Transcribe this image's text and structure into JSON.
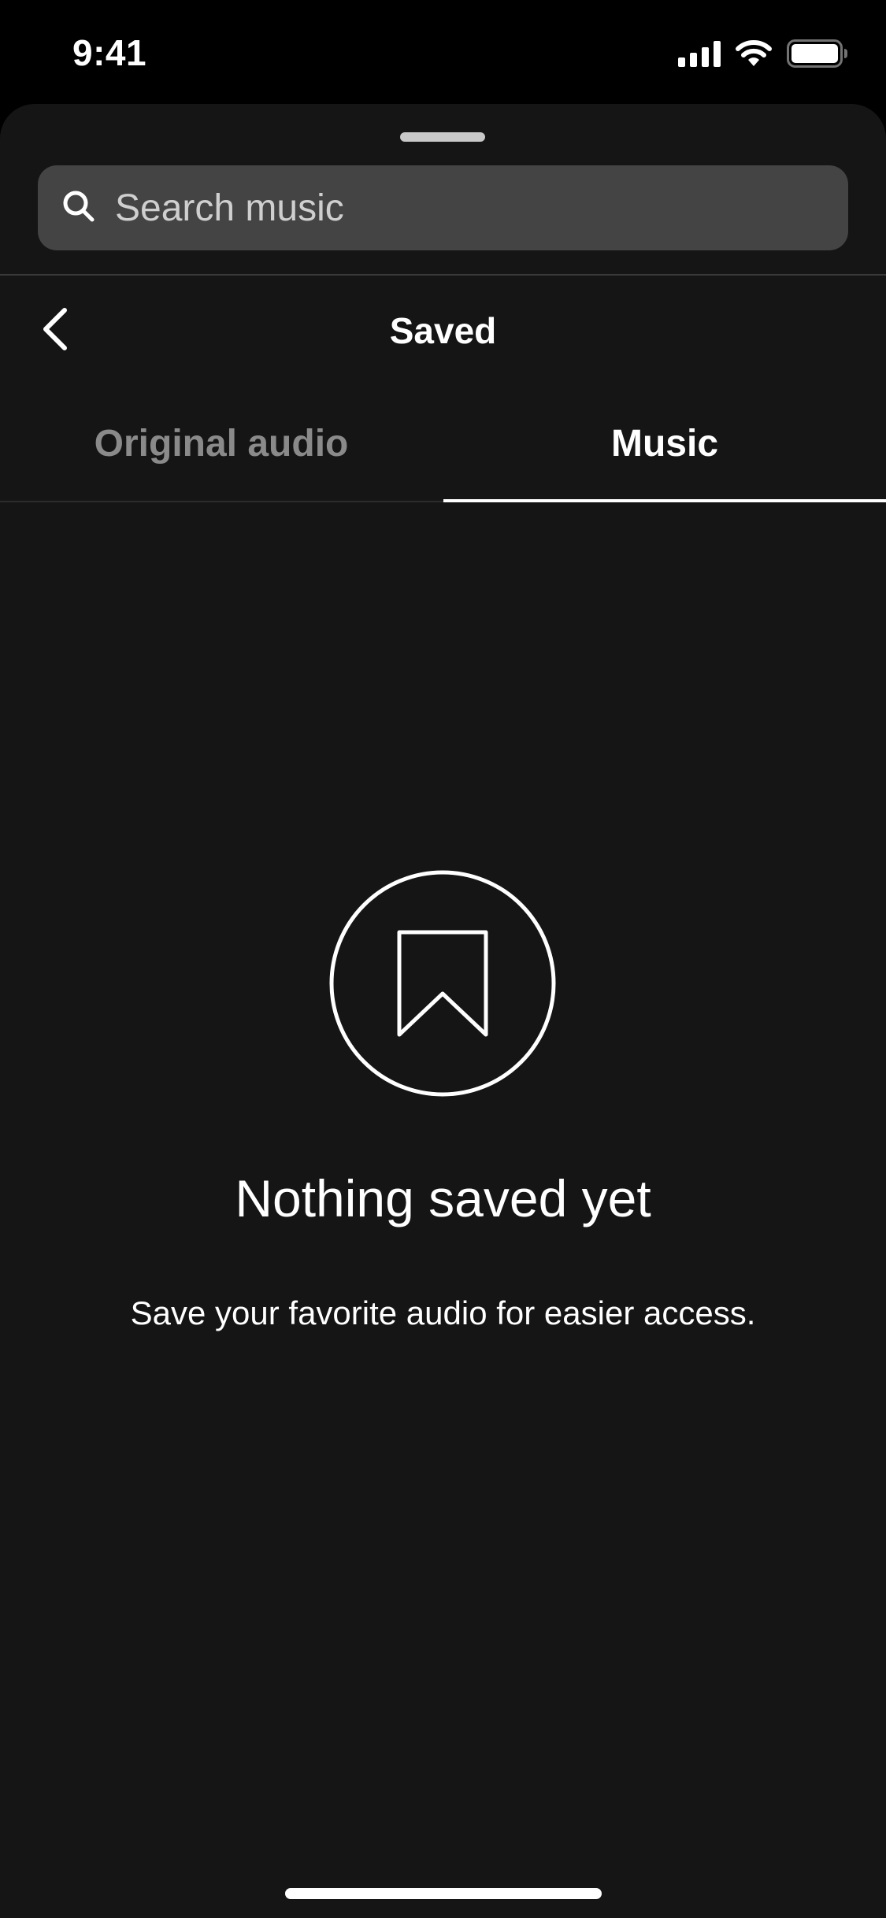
{
  "status_bar": {
    "time": "9:41",
    "icons": [
      "cellular-signal-icon",
      "wifi-icon",
      "battery-icon"
    ]
  },
  "search": {
    "placeholder": "Search music",
    "value": ""
  },
  "header": {
    "title": "Saved",
    "back_icon": "chevron-left-icon"
  },
  "tabs": [
    {
      "label": "Original audio",
      "active": false
    },
    {
      "label": "Music",
      "active": true
    }
  ],
  "empty_state": {
    "icon": "bookmark-icon",
    "title": "Nothing saved yet",
    "subtitle": "Save your favorite audio for easier access."
  },
  "colors": {
    "background": "#000000",
    "sheet": "#151515",
    "search_field": "#444444",
    "inactive_tab": "#8a8a8a",
    "active": "#ffffff"
  }
}
